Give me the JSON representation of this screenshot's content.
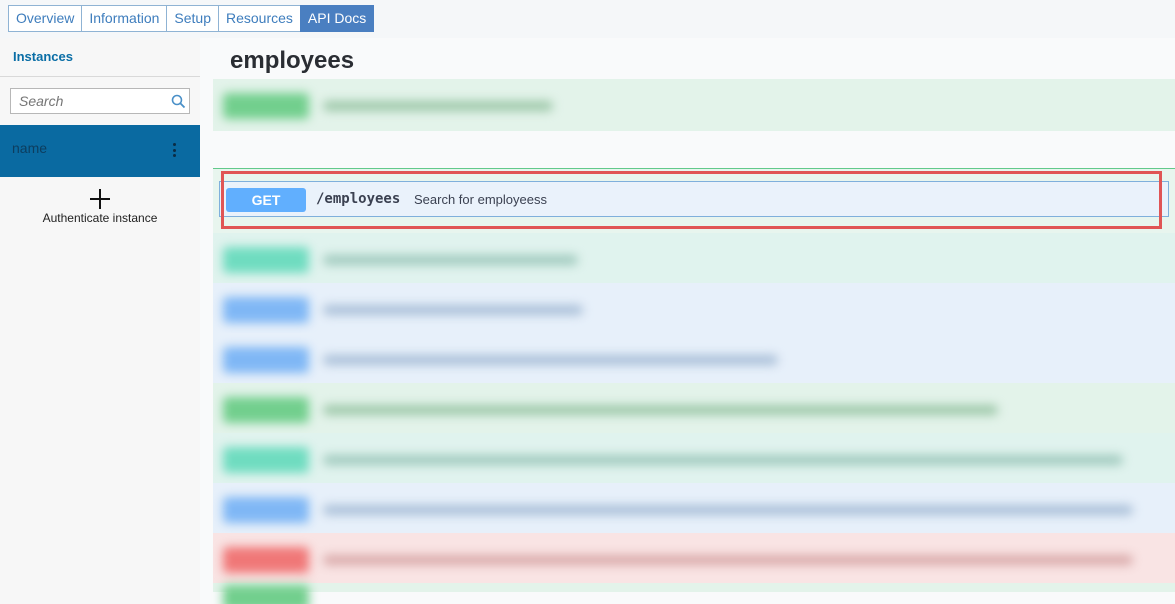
{
  "tabs": [
    {
      "label": "Overview"
    },
    {
      "label": "Information"
    },
    {
      "label": "Setup"
    },
    {
      "label": "Resources"
    },
    {
      "label": "API Docs",
      "active": true
    }
  ],
  "sidebar": {
    "title": "Instances",
    "search": {
      "placeholder": "Search",
      "value": ""
    },
    "instance": {
      "label": "name"
    },
    "authenticate_label": "Authenticate instance"
  },
  "main": {
    "title": "employees",
    "highlighted_operation": {
      "method": "GET",
      "path": "/employees",
      "summary": "Search for employeess"
    },
    "blurred_operations": [
      {
        "method": "post"
      },
      {
        "method": "put"
      },
      {
        "method": "get"
      },
      {
        "method": "get"
      },
      {
        "method": "post"
      },
      {
        "method": "put"
      },
      {
        "method": "get"
      },
      {
        "method": "delete"
      },
      {
        "method": "post"
      }
    ]
  },
  "colors": {
    "get": "#61affe",
    "post": "#49cc90",
    "put": "#50e3c2",
    "delete": "#f93e3e",
    "highlight": "#e05555",
    "active_tab": "#4a7fc1",
    "instance_bg": "#0a6aa1"
  }
}
